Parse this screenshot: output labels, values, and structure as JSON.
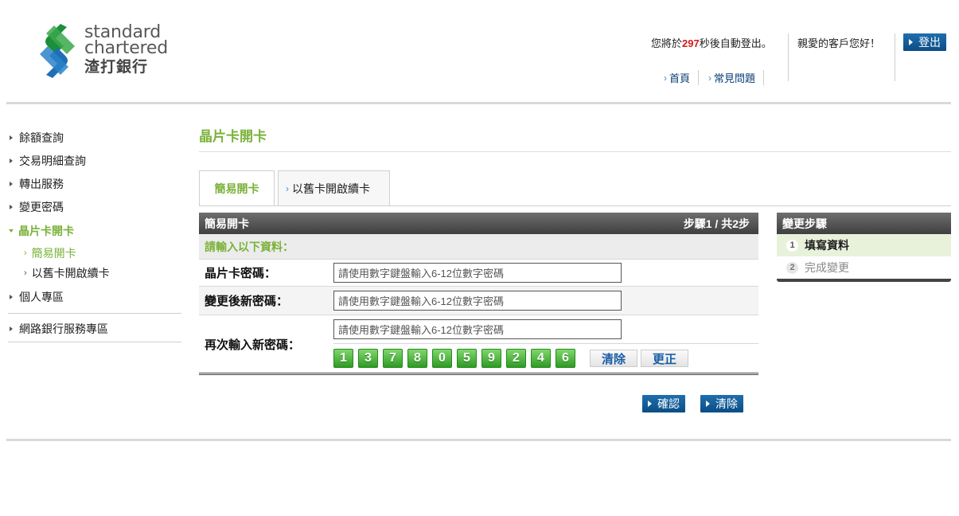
{
  "brand": {
    "logo_line1": "standard",
    "logo_line2": "chartered",
    "logo_line3": "渣打銀行"
  },
  "header": {
    "timer_prefix": "您將於",
    "timer_seconds": "297",
    "timer_suffix": "秒後自動登出。",
    "greeting": "親愛的客戶您好！",
    "logout_label": "登出",
    "links": [
      "首頁",
      "常見問題"
    ]
  },
  "sidebar": {
    "items": [
      {
        "label": "餘額查詢"
      },
      {
        "label": "交易明細查詢"
      },
      {
        "label": "轉出服務"
      },
      {
        "label": "變更密碼"
      },
      {
        "label": "晶片卡開卡"
      },
      {
        "label": "個人專區"
      },
      {
        "label": "網路銀行服務專區"
      }
    ],
    "subitems": [
      {
        "label": "簡易開卡"
      },
      {
        "label": "以舊卡開啟續卡"
      }
    ]
  },
  "main": {
    "title": "晶片卡開卡",
    "tabs": [
      {
        "label": "簡易開卡"
      },
      {
        "label": "以舊卡開啟續卡"
      }
    ],
    "panel": {
      "title": "簡易開卡",
      "step_indicator": "步驟1 / 共2步",
      "subtitle": "請輸入以下資料：",
      "fields": [
        {
          "label": "晶片卡密碼：",
          "placeholder": "請使用數字鍵盤輸入6-12位數字密碼"
        },
        {
          "label": "變更後新密碼：",
          "placeholder": "請使用數字鍵盤輸入6-12位數字密碼"
        },
        {
          "label": "再次輸入新密碼：",
          "placeholder": "請使用數字鍵盤輸入6-12位數字密碼"
        }
      ],
      "keypad_keys": [
        "1",
        "3",
        "7",
        "8",
        "0",
        "5",
        "9",
        "2",
        "4",
        "6"
      ],
      "keypad_clear": "清除",
      "keypad_correct": "更正"
    },
    "actions": {
      "confirm_label": "確認",
      "clear_label": "清除"
    }
  },
  "steps_box": {
    "title": "變更步驟",
    "steps": [
      {
        "num": "1",
        "label": "填寫資料"
      },
      {
        "num": "2",
        "label": "完成變更"
      }
    ]
  },
  "colors": {
    "accent_green": "#7ab23a",
    "brand_blue": "#0a4d85",
    "timer_red": "#d21a1a",
    "keypad_green": "#2f9a25"
  }
}
